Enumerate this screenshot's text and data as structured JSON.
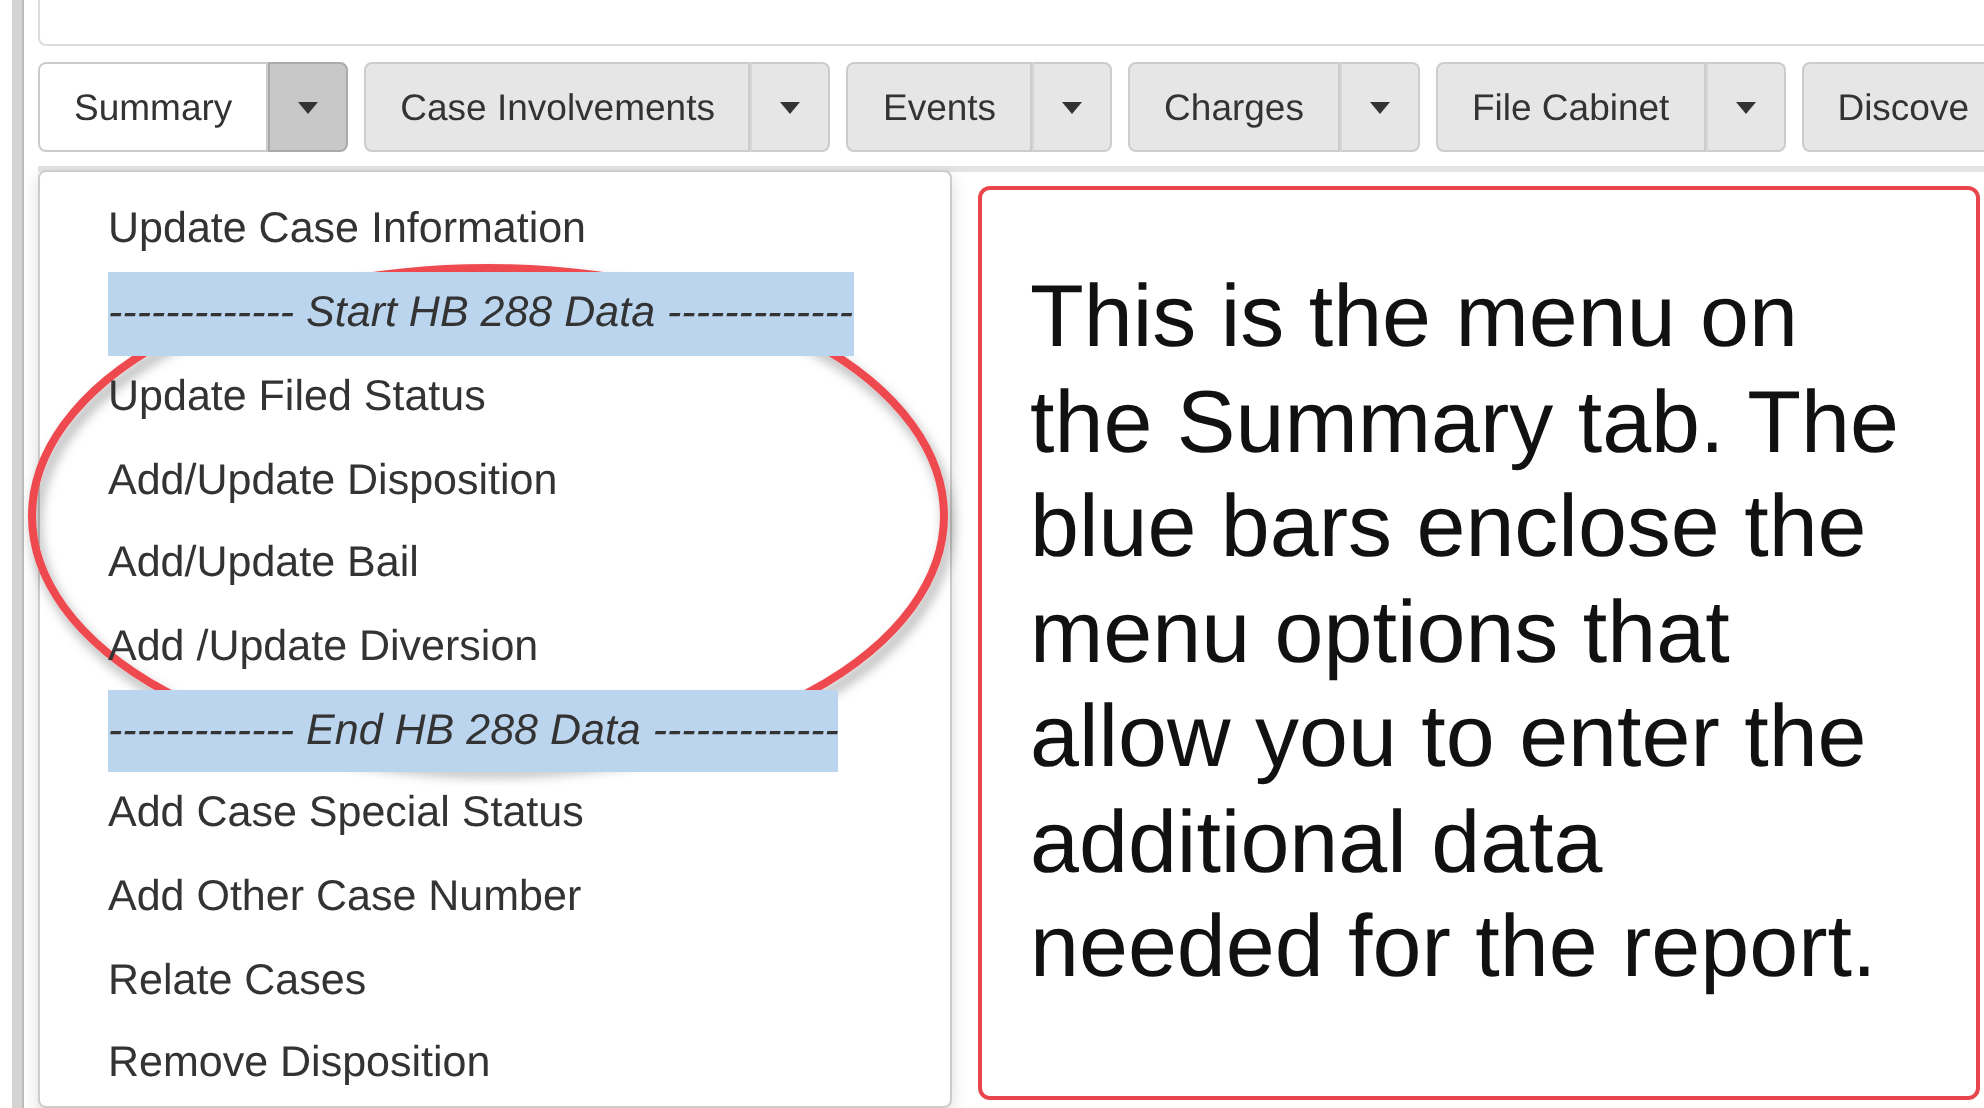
{
  "tabs": [
    {
      "label": "Summary",
      "selected": true,
      "split": true
    },
    {
      "label": "Case Involvements",
      "selected": false,
      "split": true
    },
    {
      "label": "Events",
      "selected": false,
      "split": true
    },
    {
      "label": "Charges",
      "selected": false,
      "split": true
    },
    {
      "label": "File Cabinet",
      "selected": false,
      "split": true
    },
    {
      "label": "Discove",
      "selected": false,
      "split": false
    }
  ],
  "menu": {
    "items": [
      {
        "kind": "item",
        "label": "Update Case Information"
      },
      {
        "kind": "divider",
        "label": "------------- Start HB 288 Data -------------"
      },
      {
        "kind": "item",
        "label": "Update Filed Status"
      },
      {
        "kind": "item",
        "label": "Add/Update Disposition"
      },
      {
        "kind": "item",
        "label": "Add/Update Bail"
      },
      {
        "kind": "item",
        "label": "Add /Update Diversion"
      },
      {
        "kind": "divider",
        "label": "------------- End HB 288 Data -------------"
      },
      {
        "kind": "item",
        "label": "Add Case Special Status"
      },
      {
        "kind": "item",
        "label": "Add Other Case Number"
      },
      {
        "kind": "item",
        "label": "Relate Cases"
      },
      {
        "kind": "item",
        "label": "Remove Disposition"
      }
    ]
  },
  "callout": {
    "lines": [
      "This is the menu on",
      "the Summary tab. The",
      "blue bars enclose the",
      "menu options that",
      "allow you to enter the",
      "additional data",
      "needed for the report."
    ]
  }
}
